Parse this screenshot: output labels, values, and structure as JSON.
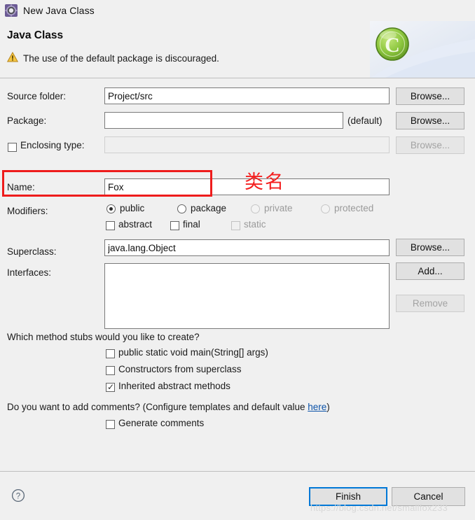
{
  "window": {
    "title": "New Java Class",
    "icon": "java-class-wizard-icon"
  },
  "header": {
    "title": "Java Class",
    "message": "The use of the default package is discouraged.",
    "warning_icon": "warning-triangle-icon",
    "banner_icon": "green-class-c-icon"
  },
  "form": {
    "source_folder": {
      "label": "Source folder:",
      "value": "Project/src",
      "browse_label": "Browse..."
    },
    "package": {
      "label": "Package:",
      "value": "",
      "hint": "(default)",
      "browse_label": "Browse..."
    },
    "enclosing_type": {
      "label": "Enclosing type:",
      "checked": false,
      "value": "",
      "browse_label": "Browse...",
      "disabled": true
    },
    "name": {
      "label": "Name:",
      "value": "Fox"
    },
    "modifiers": {
      "label": "Modifiers:",
      "access": [
        {
          "label": "public",
          "selected": true,
          "disabled": false
        },
        {
          "label": "package",
          "selected": false,
          "disabled": false
        },
        {
          "label": "private",
          "selected": false,
          "disabled": true
        },
        {
          "label": "protected",
          "selected": false,
          "disabled": true
        }
      ],
      "flags": [
        {
          "label": "abstract",
          "checked": false,
          "disabled": false
        },
        {
          "label": "final",
          "checked": false,
          "disabled": false
        },
        {
          "label": "static",
          "checked": false,
          "disabled": true
        }
      ]
    },
    "superclass": {
      "label": "Superclass:",
      "value": "java.lang.Object",
      "browse_label": "Browse..."
    },
    "interfaces": {
      "label": "Interfaces:",
      "items": [],
      "add_label": "Add...",
      "remove_label": "Remove",
      "remove_disabled": true
    },
    "stubs": {
      "question": "Which method stubs would you like to create?",
      "options": [
        {
          "label": "public static void main(String[] args)",
          "checked": false
        },
        {
          "label": "Constructors from superclass",
          "checked": false
        },
        {
          "label": "Inherited abstract methods",
          "checked": true
        }
      ]
    },
    "comments": {
      "question_before": "Do you want to add comments? (Configure templates and default value ",
      "link": "here",
      "question_after": ")",
      "option": {
        "label": "Generate comments",
        "checked": false
      }
    }
  },
  "annotation": {
    "text": "类名",
    "color": "#f41f1f"
  },
  "footer": {
    "help_icon": "help-question-icon",
    "finish_label": "Finish",
    "cancel_label": "Cancel"
  },
  "watermark": {
    "text": "https://blog.csdn.net/smallfox233"
  }
}
